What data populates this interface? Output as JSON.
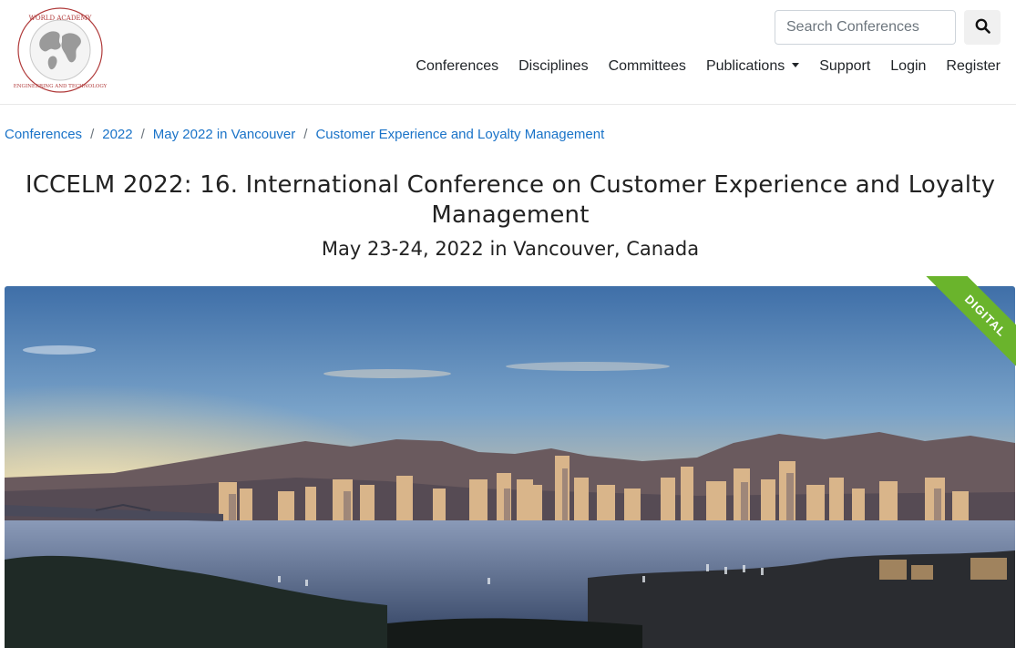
{
  "header": {
    "logo_text": "World Academy of Science, Engineering and Technology",
    "search": {
      "placeholder": "Search Conferences",
      "value": ""
    },
    "nav": [
      {
        "label": "Conferences"
      },
      {
        "label": "Disciplines"
      },
      {
        "label": "Committees"
      },
      {
        "label": "Publications",
        "has_dropdown": true
      },
      {
        "label": "Support"
      },
      {
        "label": "Login"
      },
      {
        "label": "Register"
      }
    ]
  },
  "breadcrumb": [
    "Conferences",
    "2022",
    "May 2022 in Vancouver",
    "Customer Experience and Loyalty Management"
  ],
  "page": {
    "title": "ICCELM 2022: 16. International Conference on Customer Experience and Loyalty Management",
    "subtitle": "May 23-24, 2022 in Vancouver, Canada",
    "ribbon": "DIGITAL"
  },
  "colors": {
    "link": "#1a73c8",
    "ribbon": "#6ab42c",
    "logo_red": "#b03a3a"
  }
}
